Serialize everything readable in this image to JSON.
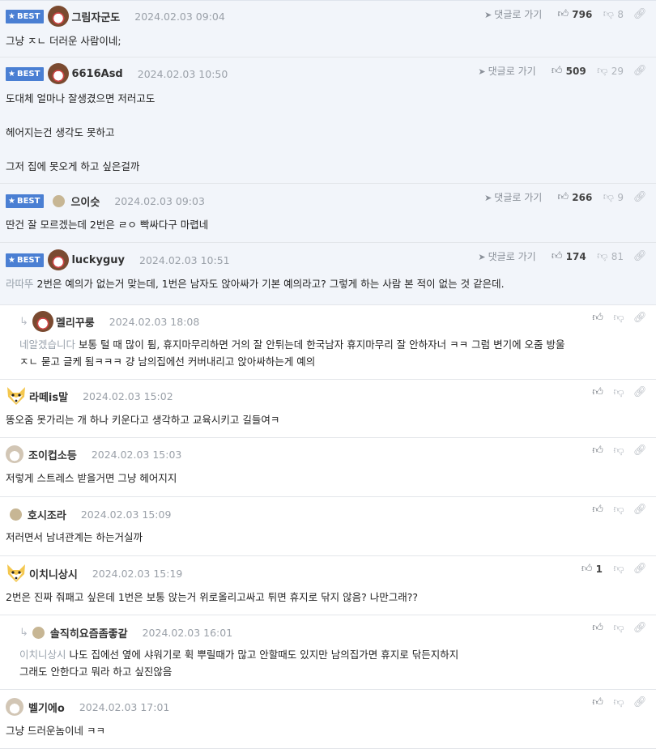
{
  "ui": {
    "best": "BEST",
    "goto": "댓글로 가기"
  },
  "comments": [
    {
      "nick": "그림자군도",
      "date": "2024.02.03 09:04",
      "up": "796",
      "down": "8",
      "mention": "",
      "lines": [
        "그냥 ㅈㄴ 더러운 사람이네;"
      ]
    },
    {
      "nick": "6616Asd",
      "date": "2024.02.03 10:50",
      "up": "509",
      "down": "29",
      "mention": "",
      "lines": [
        "도대체 얼마나 잘생겼으면 저러고도",
        "",
        "헤어지는건 생각도 못하고",
        "",
        "그저 집에 못오게 하고 싶은걸까"
      ]
    },
    {
      "nick": "으이슷",
      "date": "2024.02.03 09:03",
      "up": "266",
      "down": "9",
      "mention": "",
      "lines": [
        "딴건 잘 모르겠는데 2번은 ㄹㅇ 빡싸다구 마렵네"
      ]
    },
    {
      "nick": "luckyguy",
      "date": "2024.02.03 10:51",
      "up": "174",
      "down": "81",
      "mention": "라따뚜",
      "lines": [
        " 2번은 예의가 없는거 맞는데, 1번은 남자도 앉아싸가 기본 예의라고? 그렇게 하는 사람 본 적이 없는 것 같은데."
      ]
    },
    {
      "nick": "멜리꾸룽",
      "date": "2024.02.03 18:08",
      "up": "",
      "down": "",
      "mention": "네알겠습니다",
      "lines": [
        " 보통 털 때 많이 튐, 휴지마무리하면 거의 잘 안튀는데 한국남자 휴지마무리 잘 안하자너 ㅋㅋ 그럼 변기에 오줌 방울",
        "ㅈㄴ 묻고 글케 됨ㅋㅋㅋ 걍 남의집에선 커버내리고 앉아싸하는게 예의"
      ]
    },
    {
      "nick": "라떼is말",
      "date": "2024.02.03 15:02",
      "up": "",
      "down": "",
      "mention": "",
      "lines": [
        "똥오줌 못가리는 개 하나 키운다고 생각하고 교육시키고 길들여ㅋ"
      ]
    },
    {
      "nick": "조이컵소등",
      "date": "2024.02.03 15:03",
      "up": "",
      "down": "",
      "mention": "",
      "lines": [
        "저렇게 스트레스 받을거면 그냥 헤어지지"
      ]
    },
    {
      "nick": "호시조라",
      "date": "2024.02.03 15:09",
      "up": "",
      "down": "",
      "mention": "",
      "lines": [
        "저러면서 남녀관계는 하는거실까"
      ]
    },
    {
      "nick": "이치니상시",
      "date": "2024.02.03 15:19",
      "up": "1",
      "down": "",
      "mention": "",
      "lines": [
        "2번은 진짜 줘패고 싶은데 1번은 보통 앉는거 위로올리고싸고 튀면 휴지로 닦지 않음? 나만그래??"
      ]
    },
    {
      "nick": "솔직히요즘좀좋같",
      "date": "2024.02.03 16:01",
      "up": "",
      "down": "",
      "mention": "이치니상시",
      "lines": [
        " 나도 집에선 옆에 샤워기로 휙 뿌릴때가 많고 안할때도 있지만 남의집가면 휴지로 닦든지하지",
        "그래도 안한다고 뭐라 하고 싶진않음"
      ]
    },
    {
      "nick": "벨기에o",
      "date": "2024.02.03 17:01",
      "up": "",
      "down": "",
      "mention": "",
      "lines": [
        "그냥 드러운놈이네 ㅋㅋ"
      ]
    }
  ]
}
